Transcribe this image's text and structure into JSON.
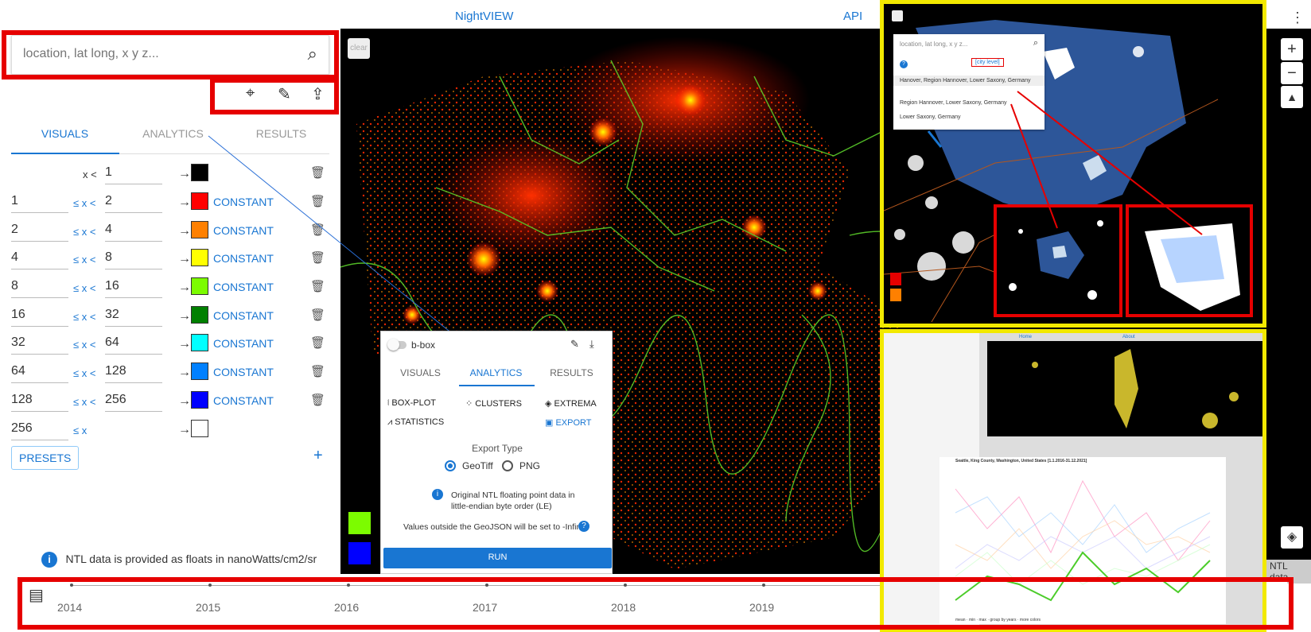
{
  "nav": {
    "title": "NightVIEW",
    "api": "API"
  },
  "search": {
    "placeholder": "location, lat long, x y z..."
  },
  "map": {
    "clear": "clear"
  },
  "tabs": [
    "VISUALS",
    "ANALYTICS",
    "RESULTS"
  ],
  "rows": [
    {
      "from": "",
      "to": "1",
      "op": "x <",
      "color": "#000000",
      "label": ""
    },
    {
      "from": "1",
      "to": "2",
      "op": "≤ x <",
      "color": "#ff0000",
      "label": "CONSTANT"
    },
    {
      "from": "2",
      "to": "4",
      "op": "≤ x <",
      "color": "#ff8000",
      "label": "CONSTANT"
    },
    {
      "from": "4",
      "to": "8",
      "op": "≤ x <",
      "color": "#ffff00",
      "label": "CONSTANT"
    },
    {
      "from": "8",
      "to": "16",
      "op": "≤ x <",
      "color": "#7cfc00",
      "label": "CONSTANT"
    },
    {
      "from": "16",
      "to": "32",
      "op": "≤ x <",
      "color": "#008000",
      "label": "CONSTANT"
    },
    {
      "from": "32",
      "to": "64",
      "op": "≤ x <",
      "color": "#00ffff",
      "label": "CONSTANT"
    },
    {
      "from": "64",
      "to": "128",
      "op": "≤ x <",
      "color": "#0080ff",
      "label": "CONSTANT"
    },
    {
      "from": "128",
      "to": "256",
      "op": "≤ x <",
      "color": "#0000ff",
      "label": "CONSTANT"
    },
    {
      "from": "256",
      "to": "",
      "op": "≤ x",
      "color": "#ffffff",
      "label": ""
    }
  ],
  "presets": "PRESETS",
  "add": "+",
  "info": "NTL data is provided as floats in nanoWatts/cm2/sr",
  "panel": {
    "bbox": "b-box",
    "tabs": [
      "VISUALS",
      "ANALYTICS",
      "RESULTS"
    ],
    "items": [
      "BOX-PLOT",
      "CLUSTERS",
      "EXTREMA",
      "STATISTICS",
      "EXPORT"
    ],
    "export_type": "Export Type",
    "geotiff": "GeoTiff",
    "png": "PNG",
    "note1": "Original NTL floating point data in",
    "note2": "little-endian byte order (LE)",
    "note3": "Values outside the GeoJSON will be set to -Infinity",
    "run": "RUN"
  },
  "timeline": {
    "years": [
      "2014",
      "2015",
      "2016",
      "2017",
      "2018",
      "2019"
    ]
  },
  "inset1": {
    "placeholder": "location, lat long, x y z...",
    "city_level": "[city level]",
    "results": [
      "Hanover, Region Hannover, Lower Saxony, Germany",
      "Region Hannover, Lower Saxony, Germany",
      "Lower Saxony, Germany"
    ]
  },
  "inset2": {
    "home": "Home",
    "about": "About",
    "title": "Seattle, King County, Washington, United States [1.1.2016-31.12.2021]",
    "legend": [
      "mean",
      "min",
      "max",
      "group by years",
      "more colors"
    ]
  },
  "ntl_tag": "NTL data"
}
